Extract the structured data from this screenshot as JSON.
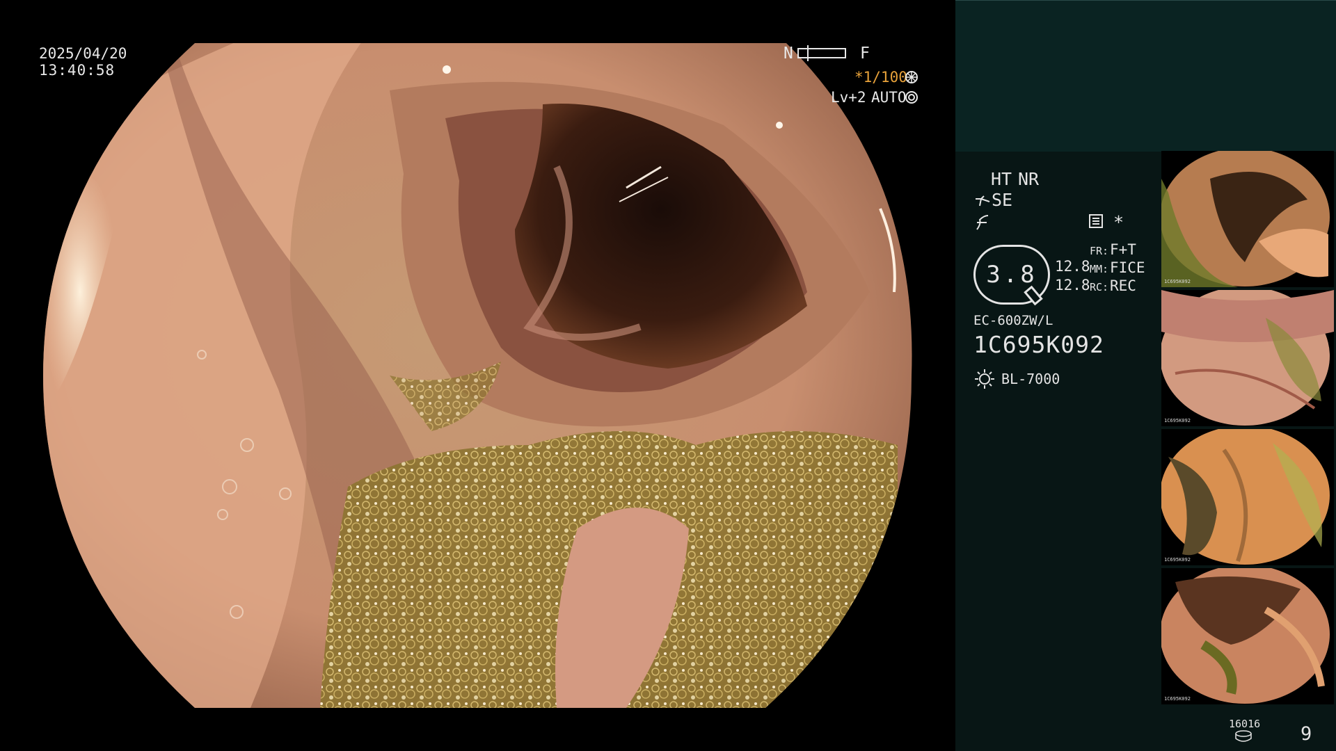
{
  "overlay": {
    "date": "2025/04/20",
    "time": "13:40:58",
    "focus_near": "N",
    "focus_far": "F",
    "shutter": "*1/100",
    "shutter_icon": "shutter-icon",
    "level": "Lv+2",
    "iris_mode": "AUTO",
    "iris_icon": "iris-icon"
  },
  "panel": {
    "ht": "HT",
    "nr": "NR",
    "se": "SE",
    "memory_icon": "memory-icon",
    "asterisk": "*",
    "zoom_value": "3.8",
    "rate_1": "12.8",
    "rate_2": "12.8",
    "fr_label": "FR:",
    "fr_value": "F+T",
    "mm_label": "MM:",
    "mm_value": "FICE",
    "rc_label": "RC:",
    "rc_value": "REC",
    "scope_model": "EC-600ZW/L",
    "scope_serial": "1C695K092",
    "light_icon": "sun-icon",
    "light_source": "BL-7000",
    "storage_count": "16016",
    "storage_icon": "disk-icon",
    "image_count": "9"
  },
  "thumbnails": [
    {
      "serial": "1C695K092",
      "tone": "green"
    },
    {
      "serial": "1C695K092",
      "tone": "pink"
    },
    {
      "serial": "1C695K092",
      "tone": "orange"
    },
    {
      "serial": "1C695K092",
      "tone": "brown"
    }
  ],
  "colors": {
    "amber": "#e8a23a",
    "panel_bg": "#081615",
    "panel_top_bg": "#0a2322"
  }
}
